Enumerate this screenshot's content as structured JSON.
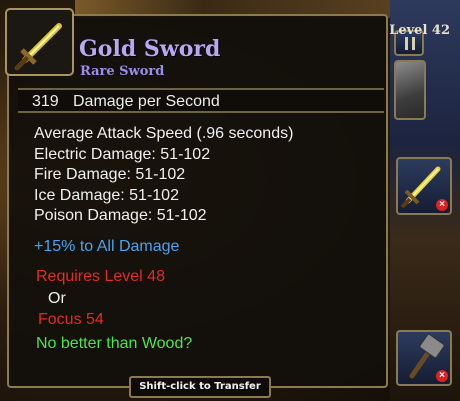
{
  "item": {
    "name": "Gold Sword",
    "rarity": "Rare Sword",
    "level": "Level 42",
    "icon": "gold-sword-icon"
  },
  "dps": {
    "value": "319",
    "label": "Damage per Second"
  },
  "stats": [
    "Average Attack Speed (.96 seconds)",
    "Electric Damage: 51-102",
    "Fire Damage: 51-102",
    "Ice Damage: 51-102",
    "Poison Damage: 51-102"
  ],
  "bonus": "+15% to All Damage",
  "requirements": {
    "first": "Requires Level 48",
    "or": "Or",
    "second": "Focus 54"
  },
  "comparison": "No better than Wood?",
  "transfer_hint": "Shift-click to Transfer",
  "colors": {
    "item_name": "#b8a8f2",
    "bonus": "#4aa2ee",
    "requirement": "#e22b24",
    "comparison": "#4fe34a",
    "border": "#8a7a4e"
  }
}
